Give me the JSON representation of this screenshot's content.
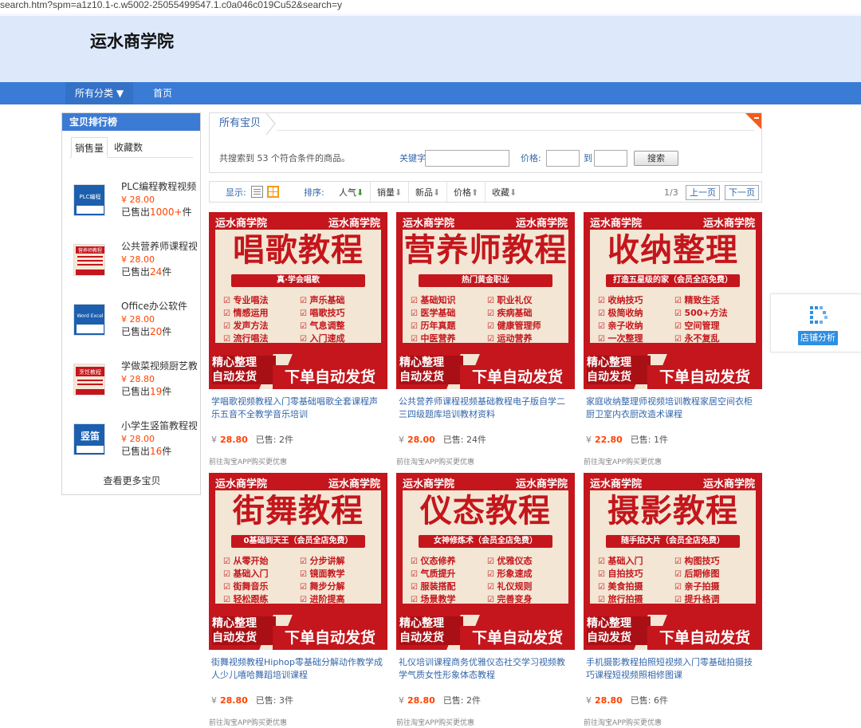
{
  "browser": {
    "url": "search.htm?spm=a1z10.1-c.w5002-25055499547.1.c0a046c019Cu52&search=y"
  },
  "header": {
    "shop_name": "运水商学院"
  },
  "nav": {
    "category_label": "所有分类 ▼",
    "home_label": "首页"
  },
  "sidebar": {
    "title": "宝贝排行榜",
    "tabs": [
      "销售量",
      "收藏数"
    ],
    "items": [
      {
        "name": "PLC编程教程视频",
        "price": "¥ 28.00",
        "sold_prefix": "已售出",
        "sold": "1000+",
        "sold_suffix": "件",
        "thumb_text": "PLC编程"
      },
      {
        "name": "公共营养师课程视频",
        "price": "¥ 28.00",
        "sold_prefix": "已售出",
        "sold": "24",
        "sold_suffix": "件",
        "thumb_text": "营养师教程"
      },
      {
        "name": "Office办公软件",
        "price": "¥ 28.00",
        "sold_prefix": "已售出",
        "sold": "20",
        "sold_suffix": "件",
        "thumb_text": "Word Excel"
      },
      {
        "name": "学做菜视频厨艺教程",
        "price": "¥ 28.80",
        "sold_prefix": "已售出",
        "sold": "19",
        "sold_suffix": "件",
        "thumb_text": "烹饪教程"
      },
      {
        "name": "小学生竖笛教程视频",
        "price": "¥ 28.00",
        "sold_prefix": "已售出",
        "sold": "16",
        "sold_suffix": "件",
        "thumb_text": "竖笛"
      }
    ],
    "more_label": "查看更多宝贝"
  },
  "main": {
    "crumb": "所有宝贝",
    "result_text": "共搜索到",
    "result_count": "53",
    "result_suffix": "个符合条件的商品。",
    "keyword_label": "关键字:",
    "price_label": "价格:",
    "to_label": "到",
    "search_button": "搜索",
    "keyword_value": "",
    "price_min": "",
    "price_max": ""
  },
  "toolbar": {
    "display_label": "显示:",
    "sort_label": "排序:",
    "sorts": [
      "人气",
      "销量",
      "新品",
      "价格",
      "收藏"
    ],
    "page_indicator": "1/3",
    "prev_label": "上一页",
    "next_label": "下一页"
  },
  "products": [
    {
      "img_left": "运水商学院",
      "img_right": "运水商学院",
      "big": "唱歌教程",
      "sub": "真·学会唱歌",
      "features": [
        "专业唱法",
        "声乐基础",
        "情感运用",
        "唱歌技巧",
        "发声方法",
        "气息调整",
        "流行唱法",
        "入门速成"
      ],
      "bl1": "精心整理",
      "bl2": "自动发货",
      "br": "下单自动发货",
      "title": "学唱歌视频教程入门零基础唱歌全套课程声乐五音不全教学音乐培训",
      "yen": "¥",
      "price": "28.80",
      "sold": "已售: 2件",
      "app": "前往淘宝APP购买更优惠"
    },
    {
      "img_left": "运水商学院",
      "img_right": "运水商学院",
      "big": "营养师教程",
      "sub": "热门黄金职业",
      "features": [
        "基础知识",
        "职业礼仪",
        "医学基础",
        "疾病基础",
        "历年真题",
        "健康管理师",
        "中医营养",
        "运动营养"
      ],
      "bl1": "精心整理",
      "bl2": "自动发货",
      "br": "下单自动发货",
      "title": "公共营养师课程视频基础教程电子版自学二三四级题库培训教材资料",
      "yen": "¥",
      "price": "28.00",
      "sold": "已售: 24件",
      "app": "前往淘宝APP购买更优惠"
    },
    {
      "img_left": "运水商学院",
      "img_right": "运水商学院",
      "big": "收纳整理",
      "sub": "打造五星级的家（会员全店免费）",
      "features": [
        "收纳技巧",
        "精致生活",
        "极简收纳",
        "500+方法",
        "亲子收纳",
        "空间管理",
        "一次整理",
        "永不复乱"
      ],
      "bl1": "精心整理",
      "bl2": "自动发货",
      "br": "下单自动发货",
      "title": "家庭收纳整理师视频培训教程家居空间衣柜厨卫室内衣厨改造术课程",
      "yen": "¥",
      "price": "22.80",
      "sold": "已售: 1件",
      "app": "前往淘宝APP购买更优惠"
    },
    {
      "img_left": "运水商学院",
      "img_right": "运水商学院",
      "big": "街舞教程",
      "sub": "0基础到天王（会员全店免费）",
      "features": [
        "从零开始",
        "分步讲解",
        "基础入门",
        "镜面教学",
        "街舞音乐",
        "舞步分解",
        "轻松跟练",
        "进阶提高"
      ],
      "bl1": "精心整理",
      "bl2": "自动发货",
      "br": "下单自动发货",
      "title": "街舞视频教程Hiphop零基础分解动作教学成人少儿嘻哈舞蹈培训课程",
      "yen": "¥",
      "price": "28.80",
      "sold": "已售: 3件",
      "app": "前往淘宝APP购买更优惠"
    },
    {
      "img_left": "运水商学院",
      "img_right": "运水商学院",
      "big": "仪态教程",
      "sub": "女神修炼术（会员全店免费）",
      "features": [
        "仪态修养",
        "优雅仪态",
        "气质提升",
        "形象速成",
        "服装搭配",
        "礼仪规则",
        "场景教学",
        "完善变身"
      ],
      "bl1": "精心整理",
      "bl2": "自动发货",
      "br": "下单自动发货",
      "title": "礼仪培训课程商务优雅仪态社交学习视频教学气质女性形象体态教程",
      "yen": "¥",
      "price": "28.80",
      "sold": "已售: 2件",
      "app": "前往淘宝APP购买更优惠"
    },
    {
      "img_left": "运水商学院",
      "img_right": "运水商学院",
      "big": "摄影教程",
      "sub": "随手拍大片（会员全店免费）",
      "features": [
        "基础入门",
        "构图技巧",
        "自拍技巧",
        "后期修图",
        "美食拍摄",
        "亲子拍摄",
        "旅行拍摄",
        "提升格调"
      ],
      "bl1": "精心整理",
      "bl2": "自动发货",
      "br": "下单自动发货",
      "title": "手机摄影教程拍照短视频入门零基础拍摄技巧课程短视频照相修图课",
      "yen": "¥",
      "price": "28.80",
      "sold": "已售: 6件",
      "app": "前往淘宝APP购买更优惠"
    }
  ],
  "float_panel": {
    "label": "店铺分析",
    "icon": "chart-logo-icon"
  },
  "colors": {
    "brand_blue": "#3a7bd5",
    "banner_bg": "#dde9fb",
    "price_orange": "#ff4400",
    "product_red": "#c4161c"
  }
}
